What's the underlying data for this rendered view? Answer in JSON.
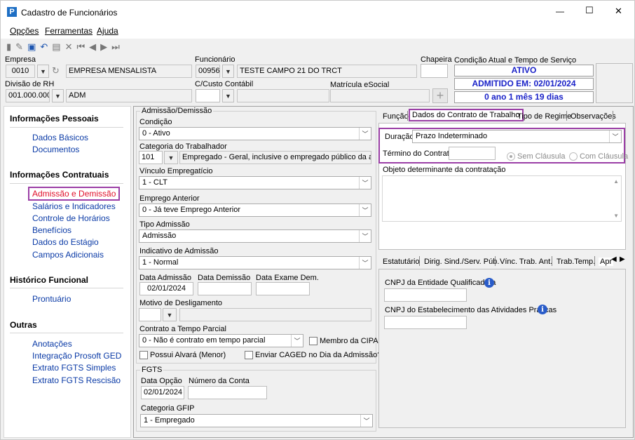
{
  "window": {
    "title": "Cadastro de Funcionários",
    "app_icon": "P",
    "minimize": "—",
    "maximize": "☐",
    "close": "✕"
  },
  "menu": {
    "opcoes": "Opções",
    "ferramentas": "Ferramentas",
    "ajuda": "Ajuda"
  },
  "header": {
    "empresa_label": "Empresa",
    "empresa_code": "0010",
    "empresa_name": "EMPRESA MENSALISTA",
    "funcionario_label": "Funcionário",
    "funcionario_code": "00956",
    "funcionario_name": "TESTE CAMPO 21 DO TRCT",
    "chapeira_label": "Chapeira",
    "chapeira_value": "",
    "condicao_label": "Condição Atual e Tempo de Serviço",
    "status": "ATIVO",
    "admitido": "ADMITIDO EM: 02/01/2024",
    "tempo": "0 ano 1 mês 19 dias",
    "divisao_label": "Divisão de RH",
    "divisao_code": "001.000.000",
    "divisao_name": "ADM",
    "ccusto_label": "C/Custo Contábil",
    "matricula_label": "Matrícula eSocial",
    "matricula_value": ""
  },
  "nav": {
    "sec1": "Informações Pessoais",
    "dados_basicos": "Dados Básicos",
    "documentos": "Documentos",
    "sec2": "Informações Contratuais",
    "admissao": "Admissão e Demissão",
    "salarios": "Salários e Indicadores",
    "controle": "Controle de Horários",
    "beneficios": "Benefícios",
    "estagio": "Dados do Estágio",
    "campos": "Campos Adicionais",
    "sec3": "Histórico Funcional",
    "prontuario": "Prontuário",
    "sec4": "Outras",
    "anotacoes": "Anotações",
    "integracao": "Integração Prosoft GED",
    "extrato_simples": "Extrato FGTS Simples",
    "extrato_rescisao": "Extrato FGTS Rescisão"
  },
  "admissao": {
    "group": "Admissão/Demissão",
    "condicao_label": "Condição",
    "condicao": "0 - Ativo",
    "categoria_label": "Categoria do Trabalhador",
    "categoria_code": "101",
    "categoria_desc": "Empregado - Geral, inclusive o empregado público da administ",
    "vinculo_label": "Vínculo Empregatício",
    "vinculo": "1 - CLT",
    "emprego_label": "Emprego Anterior",
    "emprego": "0 - Já teve Emprego Anterior",
    "tipo_label": "Tipo Admissão",
    "tipo": "Admissão",
    "indicativo_label": "Indicativo de Admissão",
    "indicativo": "1 - Normal",
    "data_adm_label": "Data Admissão",
    "data_adm": "02/01/2024",
    "data_dem_label": "Data Demissão",
    "data_dem": "",
    "data_exame_label": "Data Exame Dem.",
    "data_exame": "",
    "motivo_label": "Motivo de Desligamento",
    "parcial_label": "Contrato a Tempo Parcial",
    "parcial": "0 - Não é contrato em tempo parcial",
    "cipa": "Membro da CIPA",
    "alvara": "Possui Alvará (Menor)",
    "caged": "Enviar CAGED no Dia da Admissão?"
  },
  "fgts": {
    "group": "FGTS",
    "data_opcao_label": "Data Opção",
    "data_opcao": "02/01/2024",
    "conta_label": "Número da Conta",
    "conta": "",
    "categoria_label": "Categoria GFIP",
    "categoria": "1 - Empregado"
  },
  "tabs_top": {
    "funcao": "Função",
    "dados_contrato": "Dados do Contrato de Trabalho",
    "regime": "Tipo de Regime",
    "obs": "Observações"
  },
  "contrato": {
    "duracao_label": "Duração",
    "duracao": "Prazo Indeterminado",
    "termino_label": "Término do Contrato",
    "termino": "",
    "sem_clausula": "Sem Cláusula",
    "com_clausula": "Com Cláusula",
    "objeto_label": "Objeto determinante da contratação"
  },
  "tabs_bottom": {
    "estatutario": "Estatutário",
    "dirig": "Dirig. Sind./Serv. Púb.",
    "vinc": "Vínc. Trab. Ant.",
    "trabtemp": "Trab.Temp.",
    "apr": "Apr"
  },
  "aprendiz": {
    "cnpj_ent_label": "CNPJ da Entidade Qualificadora",
    "cnpj_est_label": "CNPJ do Estabelecimento das Atividades Práticas"
  },
  "colors": {
    "highlight": "#9b3fa6",
    "link": "#0a3aa6",
    "badge_text": "#1a22c8",
    "active_nav": "#e0102a"
  }
}
